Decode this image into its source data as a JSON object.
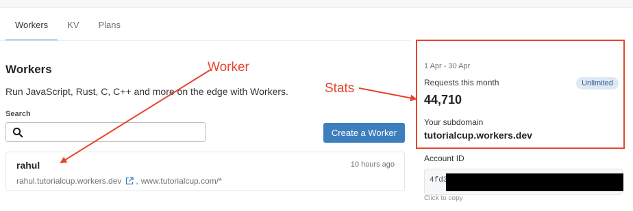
{
  "tabs": [
    {
      "label": "Workers",
      "active": true
    },
    {
      "label": "KV",
      "active": false
    },
    {
      "label": "Plans",
      "active": false
    }
  ],
  "page": {
    "title": "Workers",
    "description": "Run JavaScript, Rust, C, C++ and more on the edge with Workers."
  },
  "search": {
    "label": "Search",
    "value": "",
    "icon": "search-icon"
  },
  "create_button": "Create a Worker",
  "worker": {
    "name": "rahul",
    "time": "10 hours ago",
    "subdomain": "rahul.tutorialcup.workers.dev",
    "route_separator": ",",
    "route": "www.tutorialcup.com/*",
    "link_icon": "external-link-icon"
  },
  "stats": {
    "date_range": "1 Apr - 30 Apr",
    "requests_label": "Requests this month",
    "plan_badge": "Unlimited",
    "requests_value": "44,710",
    "subdomain_label": "Your subdomain",
    "subdomain_value": "tutorialcup.workers.dev"
  },
  "account": {
    "label": "Account ID",
    "id_prefix": "4fd3",
    "copy_hint": "Click to copy"
  },
  "annotations": {
    "worker": "Worker",
    "stats": "Stats",
    "color": "#e8432d"
  },
  "colors": {
    "accent": "#3d7fbd",
    "tab_underline": "#2c7cb0",
    "badge_bg": "#dde8f3"
  }
}
